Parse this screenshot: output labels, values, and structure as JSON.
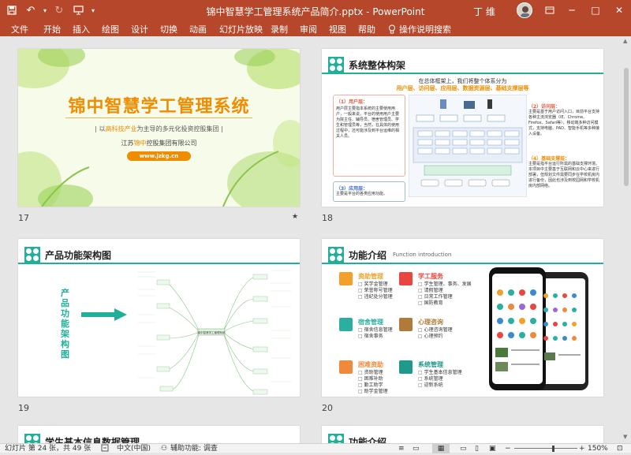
{
  "window": {
    "title": "锦中智慧学工管理系统产品简介.pptx  -  PowerPoint",
    "user": "丁 维",
    "quick_access": {
      "save": "save-icon",
      "undo": "undo-icon",
      "redo": "redo-icon",
      "present": "present-icon"
    }
  },
  "ribbon": {
    "tabs": [
      "文件",
      "开始",
      "插入",
      "绘图",
      "设计",
      "切换",
      "动画",
      "幻灯片放映",
      "录制",
      "审阅",
      "视图",
      "帮助"
    ],
    "search": "操作说明搜索"
  },
  "slides": {
    "s17": {
      "number": "17",
      "title": "锦中智慧学工管理系统",
      "tagline_pre": "| 以",
      "tagline_hl": "高科技产业",
      "tagline_post": "为主导的多元化投资控股集团 |",
      "company_pre": "江苏",
      "company_hl": "锦中",
      "company_post": "控股集团有限公司",
      "url": "www.jzkg.cn",
      "star": "★"
    },
    "s18": {
      "number": "18",
      "title": "系统整体构架",
      "intro1": "在总体框架上，我们将整个体系分为",
      "intro2": "用户层、访问层、应用层、数据资源层、基础支撑层等",
      "user_layer_title": "（1）用户层：",
      "user_layer_text": "用户层主要指本系统的主要使用用户，一般来说，平台的使用用户主要为院主任、辅导员、宿舍管理员、学生和管理员等，当然，在具体的使用过程中，还可能涉及到平台运维的相关人员。",
      "app_layer_title": "（3）应用层：",
      "app_layer_text": "主要是平台的各类应用功能。",
      "access_layer_title": "（2）访问层：",
      "access_layer_text": "主要是基于用户访问入口，目前平台支持各种主流浏览器（IE、Chrome、Firefox、Safari等），移动端多种访问模式，支持电脑、PAD、智能手机等多种接入设备。",
      "base_layer_title": "（4）基础支撑层：",
      "base_layer_text": "主要是指平台运行所需的基础支撑环境。本项目中主要基于互联网和云中心来进行部署，但规划文件需要同步在学校机房内进行备份，因此也涉及到校园网和学校机房内部网络。"
    },
    "s19": {
      "number": "19",
      "title": "产品功能架构图",
      "side_text": "产品功能架构图",
      "center_node": "锦中智慧学工管理系统"
    },
    "s20": {
      "number": "20",
      "title": "功能介绍",
      "subtitle": "Function introduction",
      "modules": [
        {
          "name": "资助管理",
          "items": [
            "奖学金管理",
            "荣誉称号管理",
            "违纪处分管理"
          ],
          "color": "#f2a02a",
          "icon": "wallet-icon"
        },
        {
          "name": "学工服务",
          "items": [
            "学生管理、事务、发展",
            "请假管理",
            "日常工作管理",
            "国防教育"
          ],
          "color": "#e8473f",
          "icon": "megaphone-icon"
        },
        {
          "name": "宿舍管理",
          "items": [
            "宿舍信息管理",
            "宿舍事务"
          ],
          "color": "#2bb0a0",
          "icon": "bed-icon"
        },
        {
          "name": "心理咨询",
          "items": [
            "心理咨询管理",
            "心理预约"
          ],
          "color": "#b07a3a",
          "icon": "person-icon"
        },
        {
          "name": "困难资助",
          "items": [
            "资助管理",
            "困难补助",
            "勤工助学",
            "助学金管理"
          ],
          "color": "#f08a3a",
          "icon": "calendar-icon"
        },
        {
          "name": "系统管理",
          "items": [
            "学生基本信息管理",
            "系统管理",
            "迎新系统"
          ],
          "color": "#1f9a8a",
          "icon": "grid-icon"
        }
      ]
    },
    "s21": {
      "title": "学生基本信息数据管理"
    },
    "s22": {
      "title": "功能介绍"
    }
  },
  "status": {
    "slide_info": "幻灯片 第 24 张，共 49 张",
    "language": "中文(中国)",
    "accessibility": "辅助功能: 调查",
    "zoom": "150%"
  },
  "colors": {
    "accent": "#b7472a",
    "teal": "#20b09a",
    "orange": "#f08c00"
  }
}
